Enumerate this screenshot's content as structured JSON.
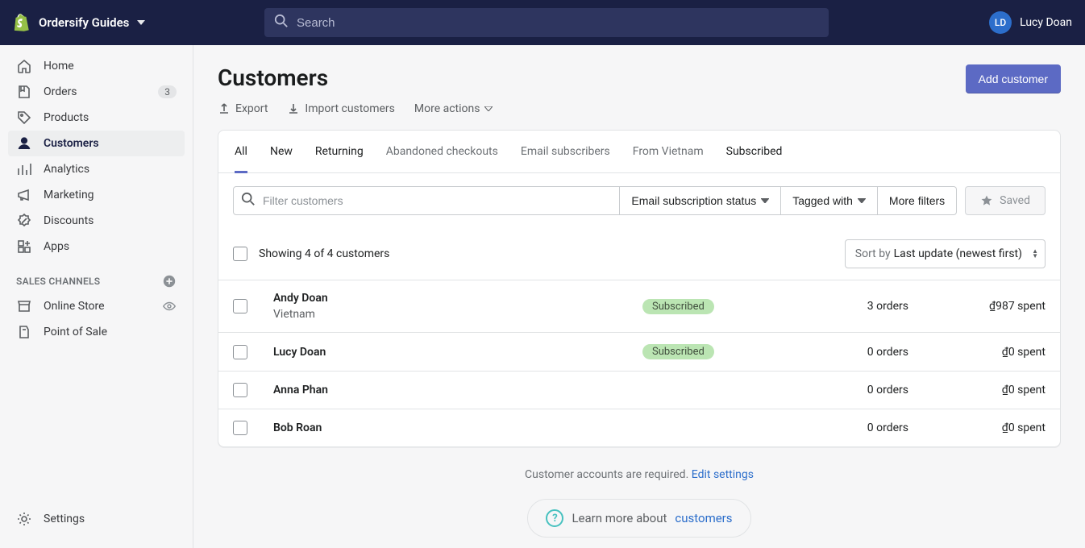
{
  "colors": {
    "primary": "#5c6ac4",
    "topbar": "#1a2044",
    "link": "#2c6ecb",
    "badge_green": "#bbe5b3"
  },
  "topbar": {
    "store_name": "Ordersify Guides",
    "search_placeholder": "Search",
    "user_initials": "LD",
    "user_name": "Lucy Doan"
  },
  "sidebar": {
    "items": [
      {
        "label": "Home"
      },
      {
        "label": "Orders",
        "badge": "3"
      },
      {
        "label": "Products"
      },
      {
        "label": "Customers",
        "active": true
      },
      {
        "label": "Analytics"
      },
      {
        "label": "Marketing"
      },
      {
        "label": "Discounts"
      },
      {
        "label": "Apps"
      }
    ],
    "section_title": "SALES CHANNELS",
    "channels": [
      {
        "label": "Online Store",
        "eye": true
      },
      {
        "label": "Point of Sale"
      }
    ],
    "settings_label": "Settings"
  },
  "page": {
    "title": "Customers",
    "export_label": "Export",
    "import_label": "Import customers",
    "more_actions_label": "More actions",
    "primary_button": "Add customer"
  },
  "tabs": [
    {
      "label": "All",
      "active": true,
      "strong": true
    },
    {
      "label": "New",
      "strong": true
    },
    {
      "label": "Returning",
      "strong": true
    },
    {
      "label": "Abandoned checkouts"
    },
    {
      "label": "Email subscribers"
    },
    {
      "label": "From Vietnam"
    },
    {
      "label": "Subscribed",
      "strong": true
    }
  ],
  "filters": {
    "placeholder": "Filter customers",
    "email_status_label": "Email subscription status",
    "tagged_with_label": "Tagged with",
    "more_filters_label": "More filters",
    "saved_label": "Saved"
  },
  "list": {
    "showing_text": "Showing 4 of 4 customers",
    "sort_prefix": "Sort by",
    "sort_value": "Last update (newest first)",
    "rows": [
      {
        "name": "Andy Doan",
        "location": "Vietnam",
        "status": "Subscribed",
        "orders": "3 orders",
        "spent": "₫987 spent"
      },
      {
        "name": "Lucy Doan",
        "location": "",
        "status": "Subscribed",
        "orders": "0 orders",
        "spent": "₫0 spent"
      },
      {
        "name": "Anna Phan",
        "location": "",
        "status": "",
        "orders": "0 orders",
        "spent": "₫0 spent"
      },
      {
        "name": "Bob Roan",
        "location": "",
        "status": "",
        "orders": "0 orders",
        "spent": "₫0 spent"
      }
    ]
  },
  "footer": {
    "note_text": "Customer accounts are required.",
    "note_link": "Edit settings",
    "learn_prefix": "Learn more about",
    "learn_link": "customers"
  }
}
